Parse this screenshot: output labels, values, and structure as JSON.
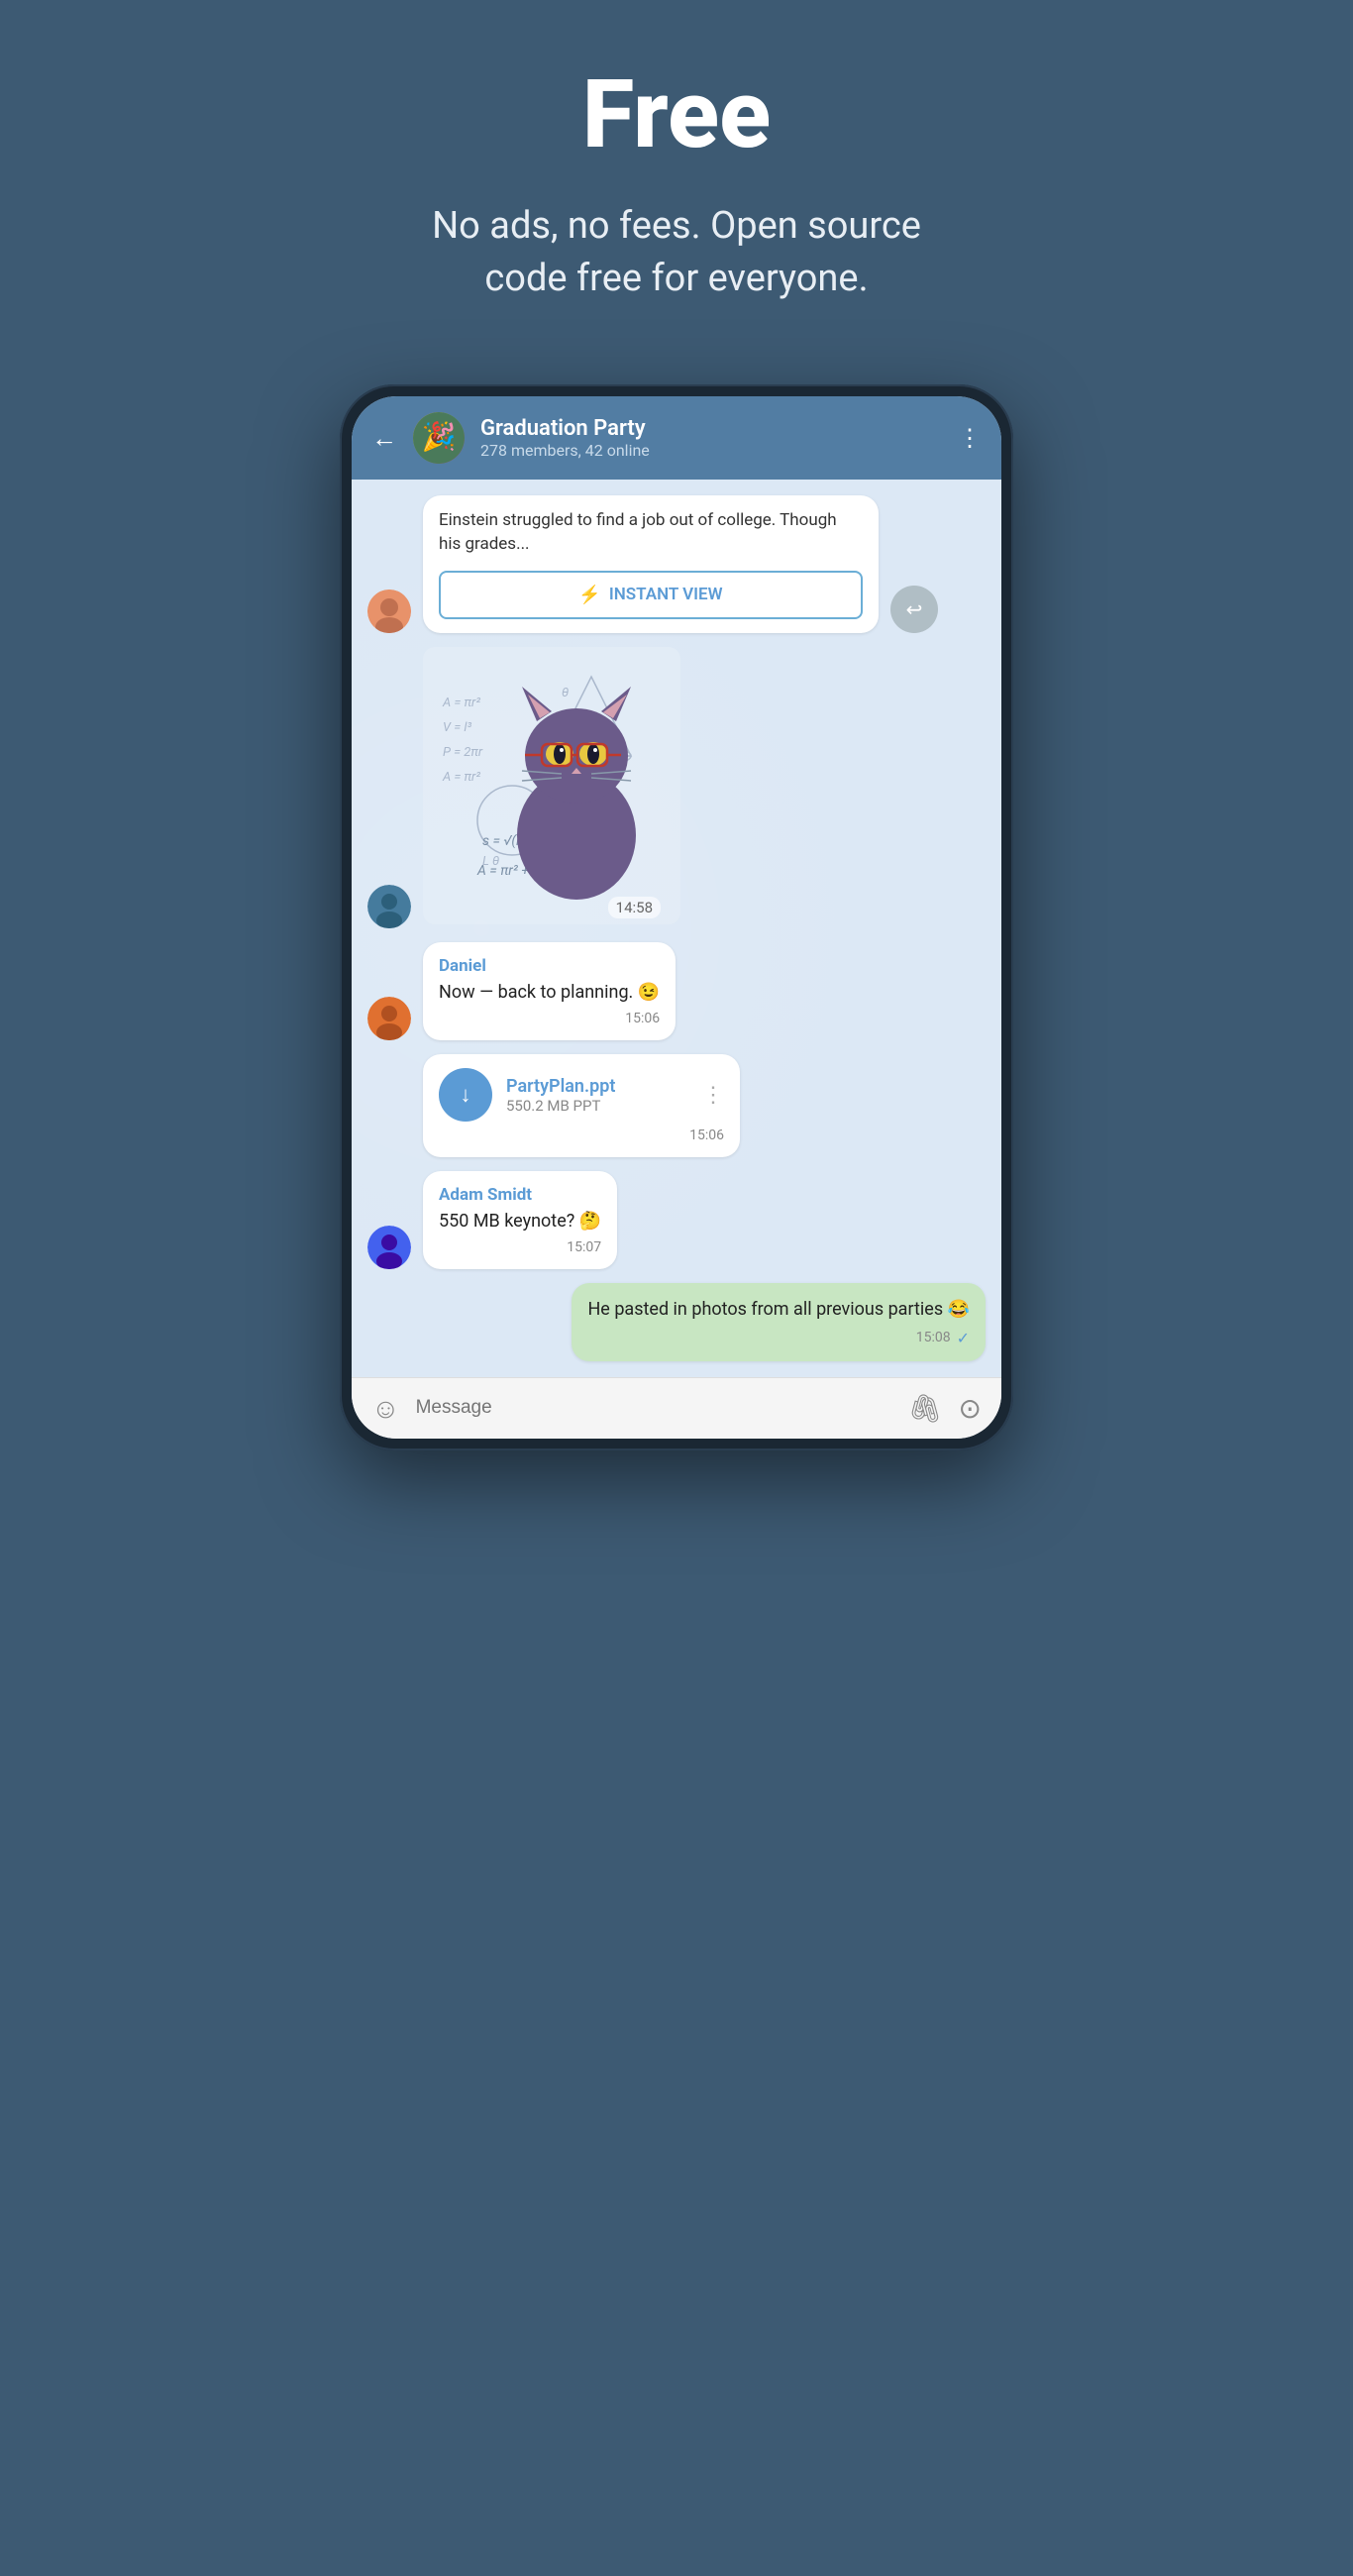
{
  "hero": {
    "title": "Free",
    "subtitle": "No ads, no fees. Open source\ncode free for everyone."
  },
  "chat": {
    "header": {
      "back_icon": "←",
      "name": "Graduation Party",
      "status": "278 members, 42 online",
      "menu_icon": "⋮"
    },
    "messages": [
      {
        "type": "link_preview",
        "sender": "female",
        "preview_text": "Einstein struggled to find a job out of college. Though his grades...",
        "instant_view_label": "INSTANT VIEW",
        "share_icon": "↩"
      },
      {
        "type": "sticker",
        "sender": "male1",
        "time": "14:58"
      },
      {
        "type": "text",
        "sender": "male2",
        "sender_name": "Daniel",
        "sender_color": "blue",
        "text": "Now — back to planning. 😉",
        "time": "15:06"
      },
      {
        "type": "file",
        "sender": "male2",
        "file_name": "PartyPlan.ppt",
        "file_size": "550.2 MB PPT",
        "time": "15:06",
        "menu_icon": "⋮",
        "download_icon": "↓"
      },
      {
        "type": "text",
        "sender": "male3",
        "sender_name": "Adam Smidt",
        "sender_color": "blue",
        "text": "550 MB keynote? 🤔",
        "time": "15:07"
      },
      {
        "type": "text_own",
        "sender": "own",
        "text": "He pasted in photos from all previous parties 😂",
        "time": "15:08",
        "check": "✓"
      }
    ],
    "input": {
      "emoji_icon": "☺",
      "placeholder": "Message",
      "attach_icon": "📎",
      "camera_icon": "⊙"
    }
  }
}
